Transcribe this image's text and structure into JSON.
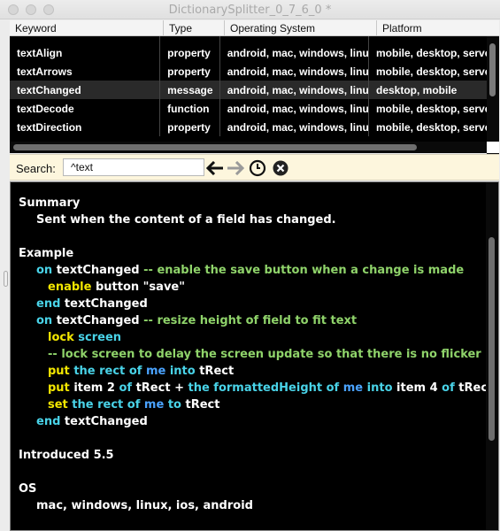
{
  "window": {
    "title": "DictionarySplitter_0_7_6_0 *"
  },
  "table": {
    "columns": [
      "Keyword",
      "Type",
      "Operating System",
      "Platform"
    ],
    "rows": [
      {
        "keyword": "textAlign",
        "type": "property",
        "os": "android, mac, windows, linux",
        "platform": "mobile, desktop, server"
      },
      {
        "keyword": "textArrows",
        "type": "property",
        "os": "android, mac, windows, linux",
        "platform": "mobile, desktop, server"
      },
      {
        "keyword": "textChanged",
        "type": "message",
        "os": "android, mac, windows, linux",
        "platform": "desktop, mobile"
      },
      {
        "keyword": "textDecode",
        "type": "function",
        "os": "android, mac, windows, linux",
        "platform": "mobile, desktop, server"
      },
      {
        "keyword": "textDirection",
        "type": "property",
        "os": "android, mac, windows, linux",
        "platform": "mobile, desktop, server"
      }
    ],
    "selected_keyword": "textChanged"
  },
  "search": {
    "label": "Search:",
    "value": "^text"
  },
  "icons": {
    "back": "back-arrow-icon",
    "forward": "forward-arrow-icon",
    "history": "clock-icon",
    "clear": "clear-x-icon"
  },
  "doc": {
    "summary_heading": "Summary",
    "summary_text": "Sent when the content of a field has changed.",
    "example_heading": "Example",
    "example_lines": [
      {
        "indent": 1,
        "parts": [
          [
            "kw-c",
            "on "
          ],
          [
            "wh",
            "textChanged "
          ],
          [
            "cm",
            "-- enable the save button when a change is made"
          ]
        ]
      },
      {
        "indent": 2,
        "parts": [
          [
            "kw-y",
            "enable "
          ],
          [
            "wh",
            "button \"save\""
          ]
        ]
      },
      {
        "indent": 1,
        "parts": [
          [
            "kw-c",
            "end "
          ],
          [
            "wh",
            "textChanged"
          ]
        ]
      },
      {
        "indent": 1,
        "parts": [
          [
            "kw-c",
            "on "
          ],
          [
            "wh",
            "textChanged "
          ],
          [
            "cm",
            "-- resize height of field to fit text"
          ]
        ]
      },
      {
        "indent": 2,
        "parts": [
          [
            "kw-y",
            "lock "
          ],
          [
            "kw-c",
            "screen"
          ]
        ]
      },
      {
        "indent": 2,
        "parts": [
          [
            "cm",
            "-- lock screen to delay the screen update so that there is no flicker"
          ]
        ]
      },
      {
        "indent": 2,
        "parts": [
          [
            "kw-y",
            "put "
          ],
          [
            "kw-c",
            "the "
          ],
          [
            "kw-c",
            "rect "
          ],
          [
            "kw-c",
            "of "
          ],
          [
            "kw-b",
            "me "
          ],
          [
            "kw-c",
            "into "
          ],
          [
            "wh",
            "tRect"
          ]
        ]
      },
      {
        "indent": 2,
        "parts": [
          [
            "kw-y",
            "put "
          ],
          [
            "wh",
            "item 2 "
          ],
          [
            "kw-c",
            "of "
          ],
          [
            "wh",
            "tRect + "
          ],
          [
            "kw-c",
            "the "
          ],
          [
            "kw-c",
            "formattedHeight "
          ],
          [
            "kw-c",
            "of "
          ],
          [
            "kw-b",
            "me "
          ],
          [
            "kw-c",
            "into "
          ],
          [
            "wh",
            "item 4 "
          ],
          [
            "kw-c",
            "of "
          ],
          [
            "wh",
            "tRect"
          ]
        ]
      },
      {
        "indent": 2,
        "parts": [
          [
            "kw-y",
            "set "
          ],
          [
            "kw-c",
            "the "
          ],
          [
            "kw-c",
            "rect "
          ],
          [
            "kw-c",
            "of "
          ],
          [
            "kw-b",
            "me "
          ],
          [
            "kw-c",
            "to "
          ],
          [
            "wh",
            "tRect"
          ]
        ]
      },
      {
        "indent": 1,
        "parts": [
          [
            "kw-c",
            "end "
          ],
          [
            "wh",
            "textChanged"
          ]
        ]
      }
    ],
    "introduced": "Introduced 5.5",
    "os_heading": "OS",
    "os_text": "mac, windows, linux, ios, android"
  }
}
